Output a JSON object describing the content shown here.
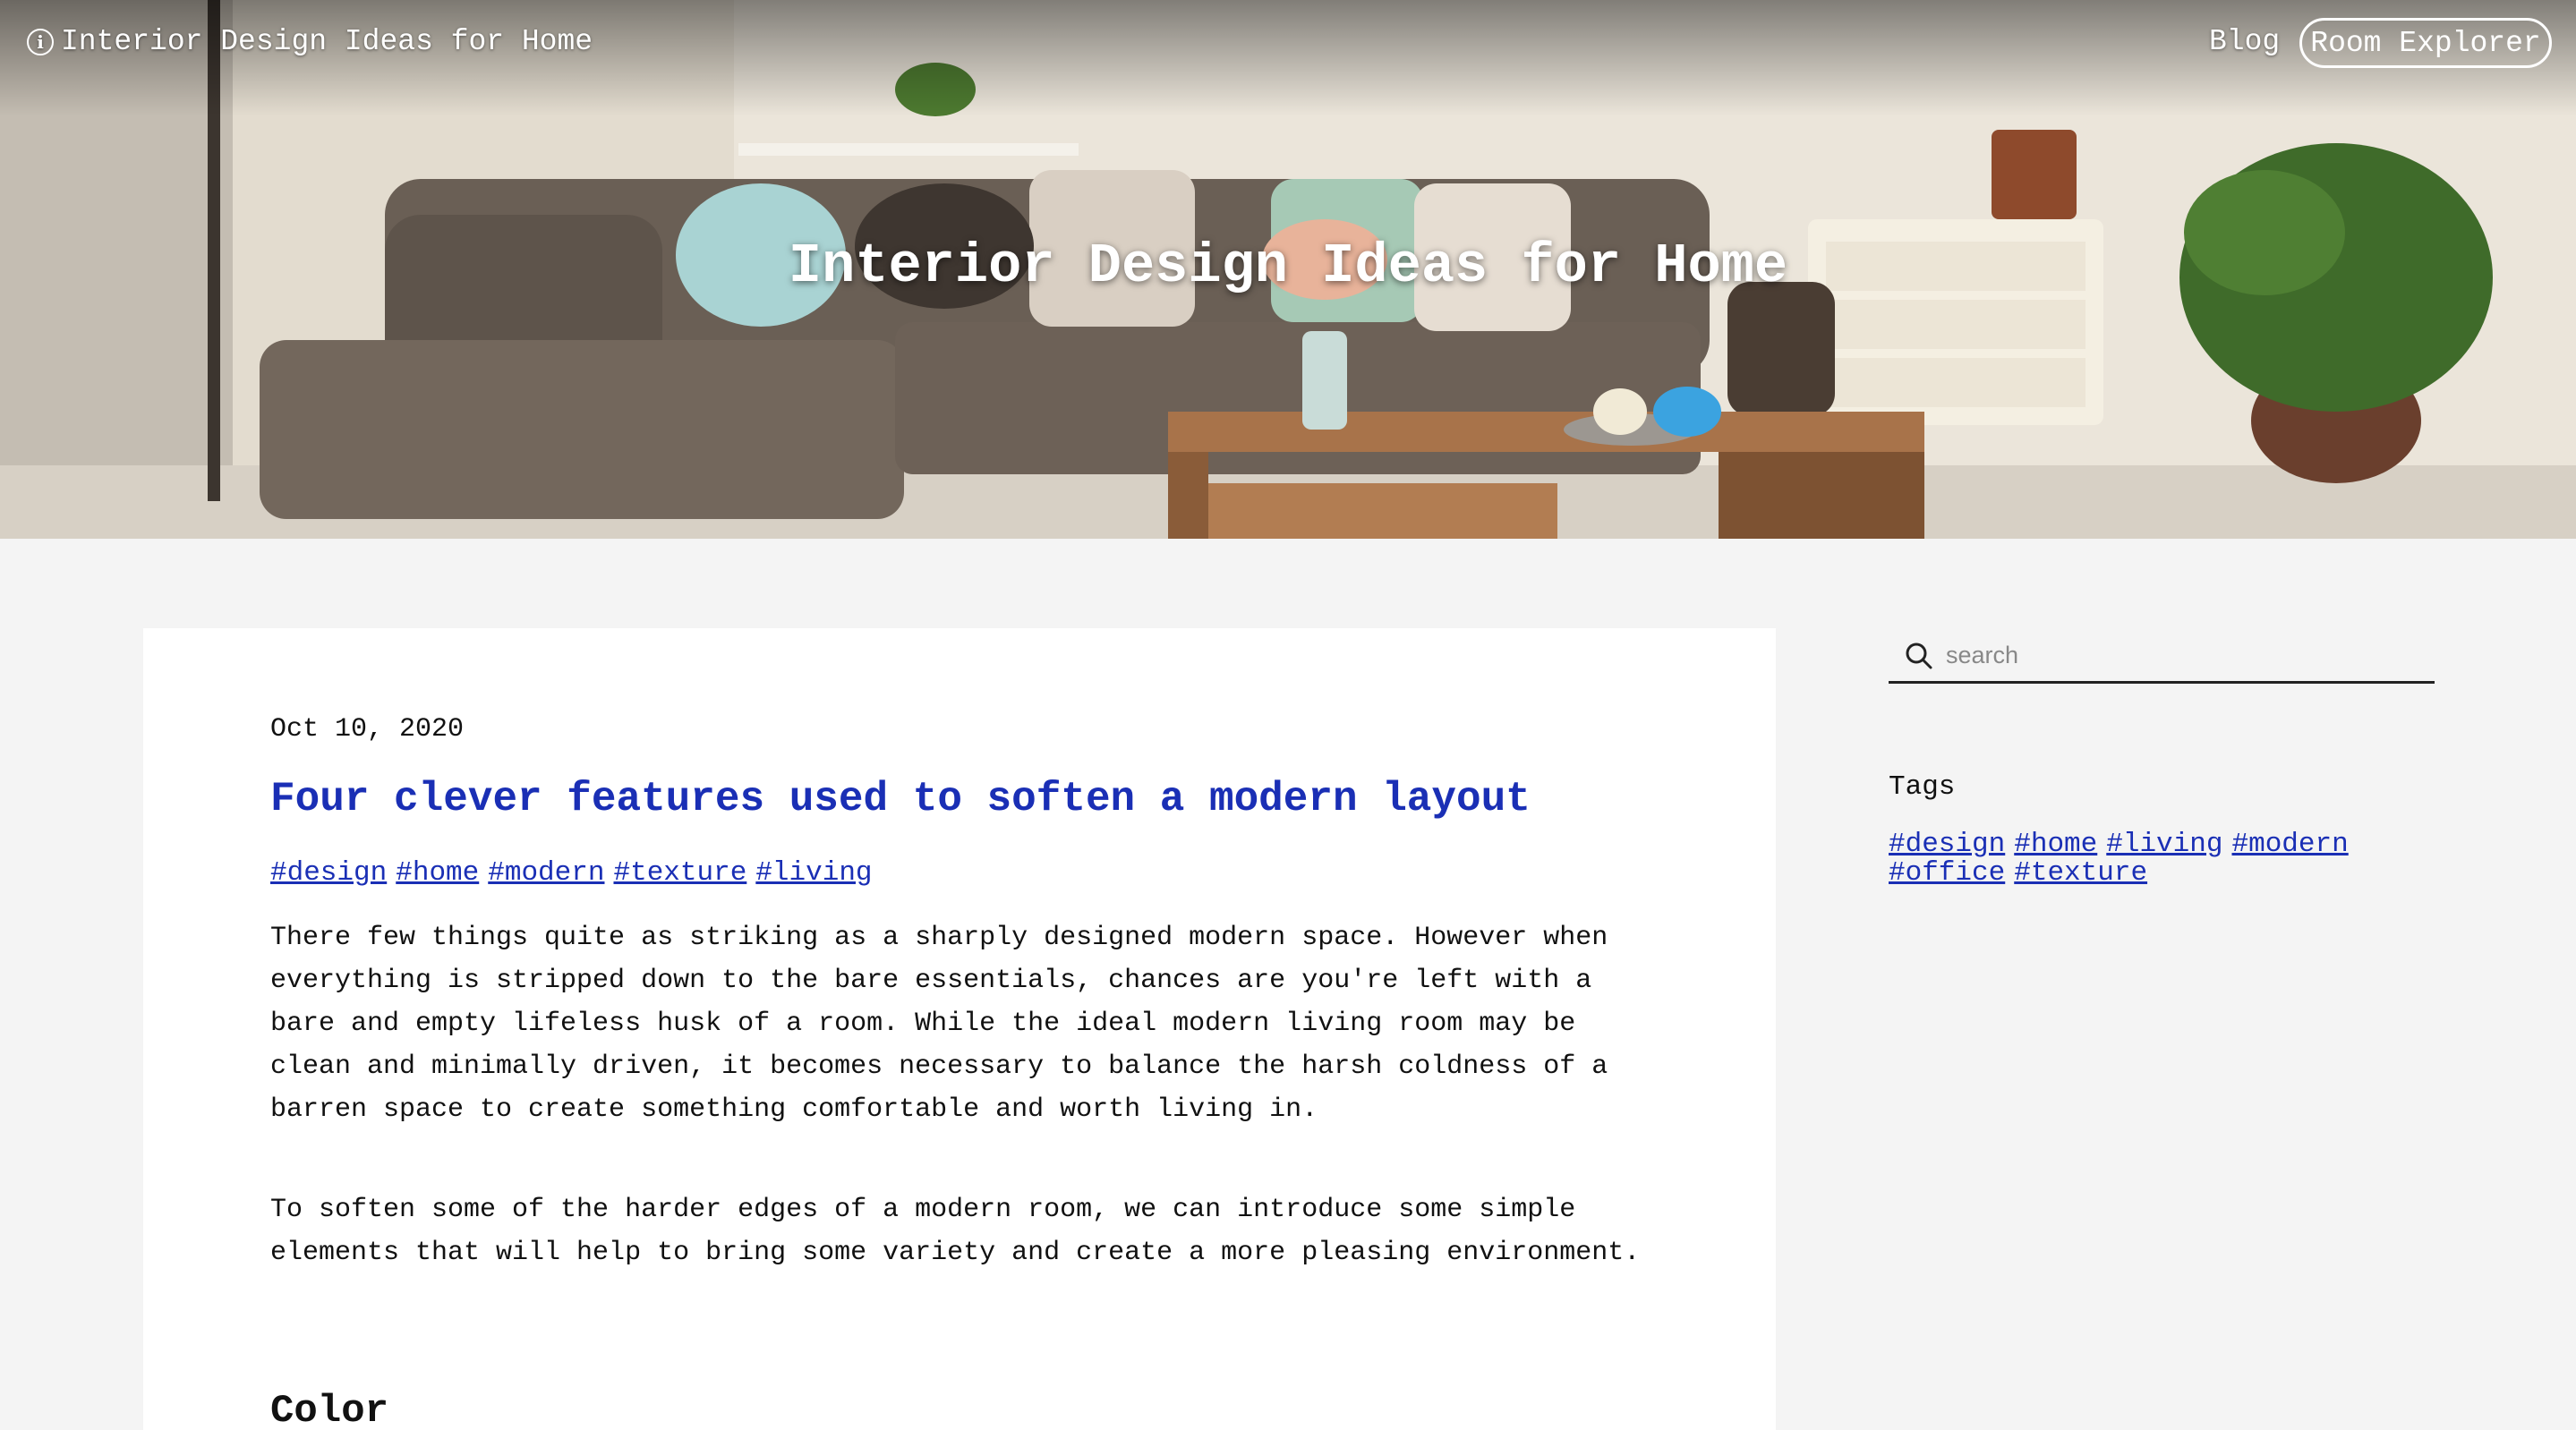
{
  "nav": {
    "brand": "Interior Design Ideas for Home",
    "blog": "Blog",
    "room_explorer": "Room Explorer"
  },
  "hero": {
    "title": "Interior Design Ideas for Home"
  },
  "post": {
    "date": "Oct 10, 2020",
    "title": "Four clever features used to soften a modern layout",
    "tags": [
      "#design",
      "#home",
      "#modern",
      "#texture",
      "#living"
    ],
    "paragraphs": [
      "There few things quite as striking as a sharply designed modern space. However when everything is stripped down to the bare essentials, chances are you're left with a bare and empty lifeless husk of a room. While the ideal modern living room may be clean and minimally driven, it becomes necessary to balance the harsh coldness of a barren space to create something comfortable and worth living in.",
      "To soften some of the harder edges of a modern room, we can introduce some simple elements that will help to bring some variety and create a more pleasing environment."
    ],
    "section_heading": "Color"
  },
  "sidebar": {
    "search_placeholder": "search",
    "tags_heading": "Tags",
    "tags": [
      "#design",
      "#home",
      "#living",
      "#modern",
      "#office",
      "#texture"
    ]
  },
  "colors": {
    "link": "#1a2fb5",
    "page_bg": "#f4f4f4",
    "card_bg": "#ffffff"
  }
}
